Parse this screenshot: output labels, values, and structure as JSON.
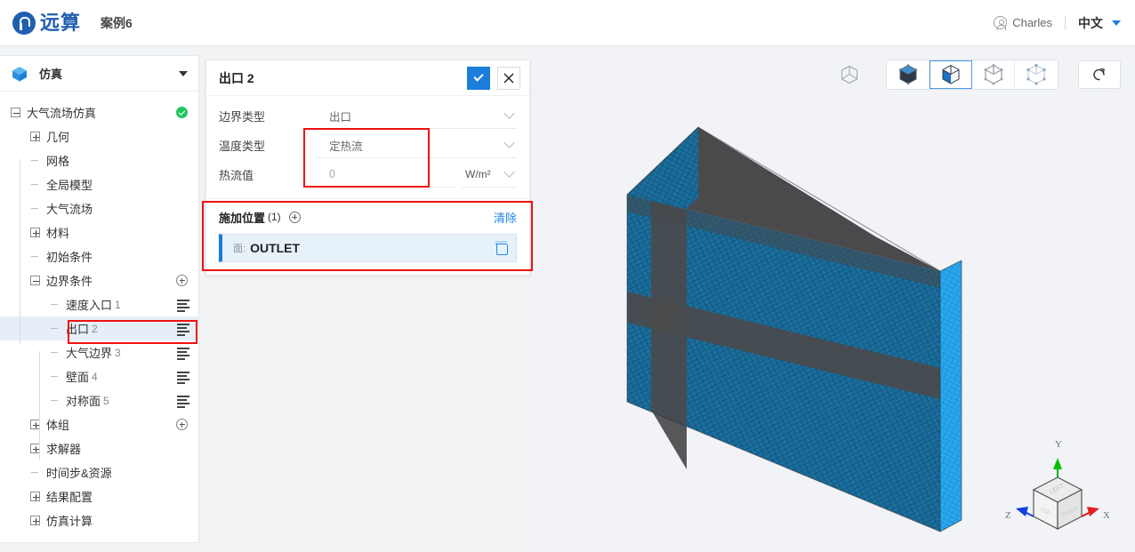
{
  "topbar": {
    "logo_icon": "yuansuan-logo-icon",
    "logo_text": "远算",
    "project_name": "案例6",
    "user_icon": "user-avatar-icon",
    "user_name": "Charles",
    "language": "中文",
    "lang_caret_icon": "caret-down-icon"
  },
  "tree_panel": {
    "header": {
      "icon": "cube-icon",
      "label": "仿真",
      "caret_icon": "caret-down-icon"
    },
    "items": [
      {
        "label": "大气流场仿真",
        "indent": 0,
        "toggle": "minus",
        "badge": "status-ok",
        "index": ""
      },
      {
        "label": "几何",
        "indent": 1,
        "toggle": "plus",
        "badge": "",
        "index": ""
      },
      {
        "label": "网格",
        "indent": 1,
        "toggle": "dash",
        "badge": "",
        "index": ""
      },
      {
        "label": "全局模型",
        "indent": 1,
        "toggle": "dash",
        "badge": "",
        "index": ""
      },
      {
        "label": "大气流场",
        "indent": 1,
        "toggle": "dash",
        "badge": "",
        "index": ""
      },
      {
        "label": "材料",
        "indent": 1,
        "toggle": "plus",
        "badge": "",
        "index": ""
      },
      {
        "label": "初始条件",
        "indent": 1,
        "toggle": "dash",
        "badge": "",
        "index": ""
      },
      {
        "label": "边界条件",
        "indent": 1,
        "toggle": "minus",
        "badge": "plus-circle",
        "index": ""
      },
      {
        "label": "速度入口",
        "indent": 2,
        "toggle": "dash",
        "badge": "eq",
        "index": "1"
      },
      {
        "label": "出口",
        "indent": 2,
        "toggle": "dash",
        "badge": "eq",
        "index": "2",
        "selected": true
      },
      {
        "label": "大气边界",
        "indent": 2,
        "toggle": "dash",
        "badge": "eq",
        "index": "3"
      },
      {
        "label": "壁面",
        "indent": 2,
        "toggle": "dash",
        "badge": "eq",
        "index": "4"
      },
      {
        "label": "对称面",
        "indent": 2,
        "toggle": "dash",
        "badge": "eq",
        "index": "5"
      },
      {
        "label": "体组",
        "indent": 1,
        "toggle": "plus",
        "badge": "plus-circle",
        "index": ""
      },
      {
        "label": "求解器",
        "indent": 1,
        "toggle": "plus",
        "badge": "",
        "index": ""
      },
      {
        "label": "时间步&资源",
        "indent": 1,
        "toggle": "dash",
        "badge": "",
        "index": ""
      },
      {
        "label": "结果配置",
        "indent": 1,
        "toggle": "plus",
        "badge": "",
        "index": ""
      },
      {
        "label": "仿真计算",
        "indent": 1,
        "toggle": "plus",
        "badge": "",
        "index": ""
      }
    ]
  },
  "properties": {
    "title": "出口 2",
    "confirm_icon": "check-icon",
    "cancel_icon": "close-icon",
    "fields": [
      {
        "label": "边界类型",
        "value": "出口",
        "unit": "",
        "chevron": "chevron-down-icon"
      },
      {
        "label": "温度类型",
        "value": "定热流",
        "unit": "",
        "chevron": "chevron-down-icon"
      },
      {
        "label": "热流值",
        "value": "0",
        "unit": "W/m²",
        "chevron": "chevron-down-icon"
      }
    ],
    "location": {
      "title": "施加位置",
      "count": "(1)",
      "add_icon": "plus-circle-icon",
      "clear_label": "清除",
      "items": [
        {
          "kind": "面:",
          "name": "OUTLET",
          "delete_icon": "trash-icon"
        }
      ]
    }
  },
  "viewport": {
    "toolbar": [
      {
        "name": "wireframe-cube-icon",
        "active": false,
        "group": "loose"
      },
      {
        "name": "solid-cube-icon",
        "active": false,
        "group": "main"
      },
      {
        "name": "solid-shaded-cube-icon",
        "active": true,
        "group": "main"
      },
      {
        "name": "outline-cube-icon",
        "active": false,
        "group": "main"
      },
      {
        "name": "points-cube-icon",
        "active": false,
        "group": "main"
      },
      {
        "name": "reset-view-icon",
        "active": false,
        "group": "single"
      }
    ],
    "gizmo": {
      "axes": [
        {
          "label": "Y",
          "color": "#00c000"
        },
        {
          "label": "X",
          "color": "#e02020"
        },
        {
          "label": "Z",
          "color": "#1040e0"
        }
      ],
      "cube_faces": [
        "LEFT",
        "TOP",
        "FRONT"
      ]
    },
    "model": {
      "mesh_color": "#1b6e9e",
      "dark_face_color": "#4a4a4c",
      "highlight_face_color": "#28a8f0",
      "background": "#f1f3f6"
    }
  },
  "annotations": {
    "highlight_color": "#ee1111",
    "boxes": [
      {
        "name": "sidebar-outlet-highlight"
      },
      {
        "name": "temperature-fields-highlight"
      },
      {
        "name": "location-section-highlight"
      }
    ]
  }
}
